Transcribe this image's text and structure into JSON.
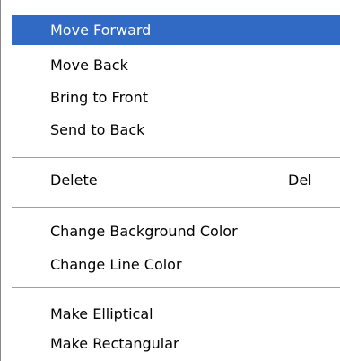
{
  "menu": {
    "items": [
      {
        "label": "Move Forward"
      },
      {
        "label": "Move Back"
      },
      {
        "label": "Bring to Front"
      },
      {
        "label": "Send to Back"
      },
      {
        "label": "Delete",
        "shortcut": "Del"
      },
      {
        "label": "Change Background Color"
      },
      {
        "label": "Change Line Color"
      },
      {
        "label": "Make Elliptical"
      },
      {
        "label": "Make Rectangular"
      }
    ],
    "selected_item": "Move Forward",
    "colors": {
      "highlight": "#316ac5",
      "highlight_text": "#ffffff",
      "separator": "#a0a0a0"
    }
  }
}
